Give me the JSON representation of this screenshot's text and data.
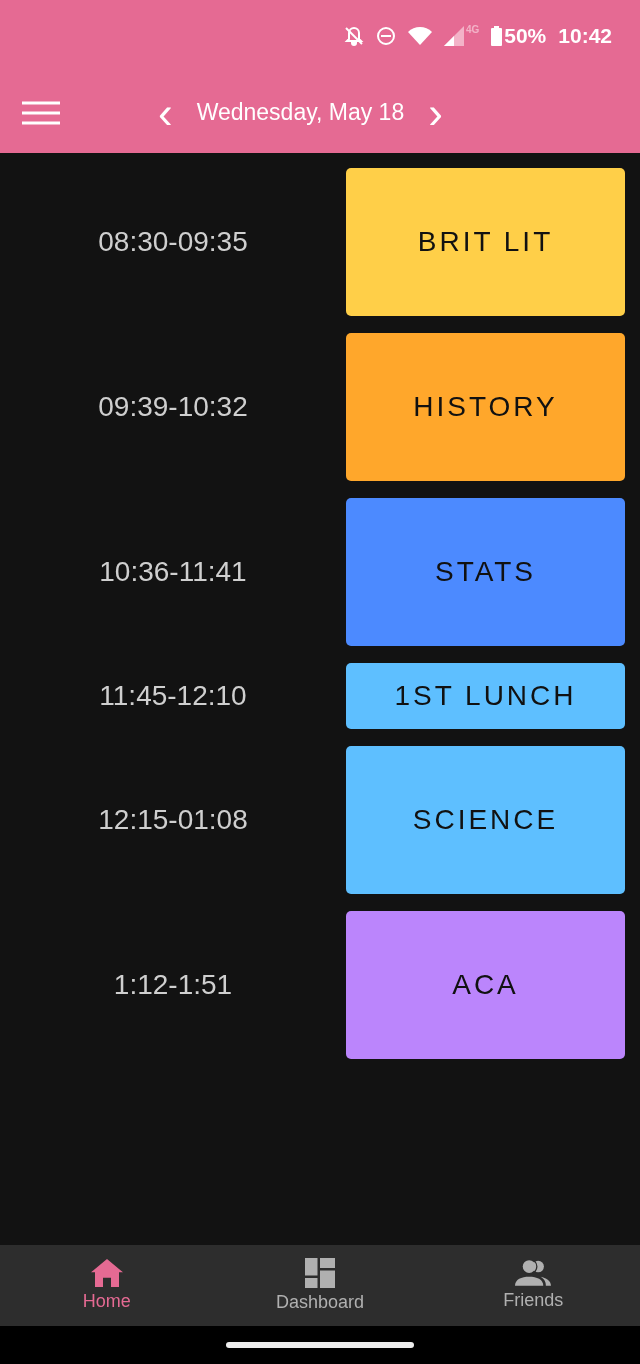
{
  "status_bar": {
    "battery": "50%",
    "time": "10:42",
    "network": "4G"
  },
  "toolbar": {
    "prev": "‹",
    "date": "Wednesday, May 18",
    "next": "›"
  },
  "schedule": [
    {
      "time": "08:30-09:35",
      "name": "BRIT LIT",
      "color": "#ffcf48",
      "kind": "period"
    },
    {
      "time": "09:39-10:32",
      "name": "HISTORY",
      "color": "#ffa72b",
      "kind": "period"
    },
    {
      "time": "10:36-11:41",
      "name": "STATS",
      "color": "#4c8aff",
      "kind": "period"
    },
    {
      "time": "11:45-12:10",
      "name": "1ST LUNCH",
      "color": "#5ebfff",
      "kind": "lunch"
    },
    {
      "time": "12:15-01:08",
      "name": "SCIENCE",
      "color": "#5ebfff",
      "kind": "period"
    },
    {
      "time": "1:12-1:51",
      "name": "ACA",
      "color": "#bb85fc",
      "kind": "period"
    }
  ],
  "bottom_nav": [
    {
      "label": "Home",
      "kind": "home",
      "selected": true
    },
    {
      "label": "Dashboard",
      "kind": "dashboard",
      "selected": false
    },
    {
      "label": "Friends",
      "kind": "friends",
      "selected": false
    }
  ]
}
